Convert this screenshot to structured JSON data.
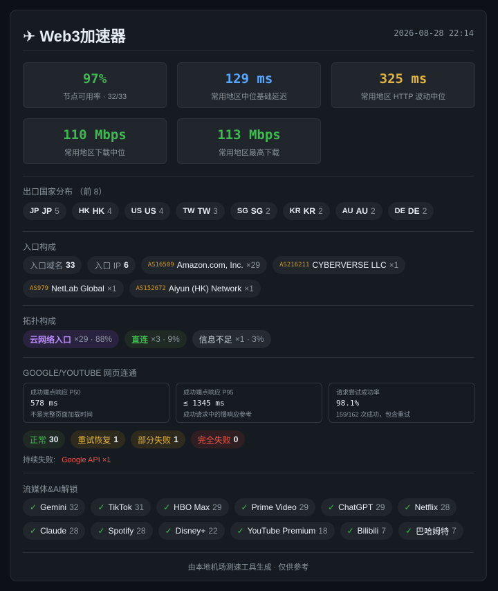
{
  "header": {
    "plane_icon": "airplane-icon",
    "title": "Web3加速器",
    "datetime": "2026-08-28 22:14"
  },
  "stats": [
    {
      "value": "97%",
      "label": "节点可用率 · 32/33",
      "color": "#3fb950"
    },
    {
      "value": "129 ms",
      "label": "常用地区中位基础延迟",
      "color": "#58a6ff"
    },
    {
      "value": "325 ms",
      "label": "常用地区 HTTP 波动中位",
      "color": "#e3b341"
    },
    {
      "value": "110 Mbps",
      "label": "常用地区下载中位",
      "color": "#3fb950"
    },
    {
      "value": "113 Mbps",
      "label": "常用地区最高下载",
      "color": "#3fb950"
    }
  ],
  "countries": {
    "title": "出口国家分布 （前 8）",
    "items": [
      {
        "code": "JP",
        "name": "JP",
        "count": "5"
      },
      {
        "code": "HK",
        "name": "HK",
        "count": "4"
      },
      {
        "code": "US",
        "name": "US",
        "count": "4"
      },
      {
        "code": "TW",
        "name": "TW",
        "count": "3"
      },
      {
        "code": "SG",
        "name": "SG",
        "count": "2"
      },
      {
        "code": "KR",
        "name": "KR",
        "count": "2"
      },
      {
        "code": "AU",
        "name": "AU",
        "count": "2"
      },
      {
        "code": "DE",
        "name": "DE",
        "count": "2"
      }
    ]
  },
  "entry": {
    "title": "入口构成",
    "domain_label": "入口域名",
    "domain_count": "33",
    "ip_label": "入口 IP",
    "ip_count": "6",
    "asns": [
      {
        "asn": "AS16509",
        "name": "Amazon.com, Inc.",
        "count": "×29"
      },
      {
        "asn": "AS216211",
        "name": "CYBERVERSE LLC",
        "count": "×1"
      },
      {
        "asn": "AS979",
        "name": "NetLab Global",
        "count": "×1"
      },
      {
        "asn": "AS152672",
        "name": "Aiyun (HK) Network",
        "count": "×1"
      }
    ]
  },
  "topology": {
    "title": "拓扑构成",
    "items": [
      {
        "tag": "云网络入口",
        "detail": "×29 · 88%",
        "color": "#bc8cff",
        "bg": "#2a2340"
      },
      {
        "tag": "直连",
        "detail": "×3 · 9%",
        "color": "#3fb950",
        "bg": "#1f2a24"
      },
      {
        "tag": "信息不足",
        "detail": "×1 · 3%",
        "color": "#c9d1d9",
        "bg": "#262b32"
      }
    ]
  },
  "google": {
    "title": "GOOGLE/YOUTUBE 网页连通",
    "metrics": [
      {
        "label": "成功端点响应 P50",
        "value": "578 ms",
        "note": "不是完整页面加载时间"
      },
      {
        "label": "成功端点响应 P95",
        "value": "≤ 1345 ms",
        "note": "成功请求中的慢响应参考"
      },
      {
        "label": "请求尝试成功率",
        "value": "98.1%",
        "note": "159/162 次成功，包含重试"
      }
    ],
    "statuses": [
      {
        "label": "正常",
        "count": "30",
        "color": "#3fb950",
        "bg": "#1f2a24"
      },
      {
        "label": "重试恢复",
        "count": "1",
        "color": "#e3b341",
        "bg": "#2e2a1e"
      },
      {
        "label": "部分失败",
        "count": "1",
        "color": "#e3b341",
        "bg": "#2e2a1e"
      },
      {
        "label": "完全失败",
        "count": "0",
        "color": "#f85149",
        "bg": "#2f1f22"
      }
    ],
    "persist_label": "持续失败:",
    "persist_value": "Google API ×1"
  },
  "streaming": {
    "title": "流媒体&AI解锁",
    "items": [
      {
        "name": "Gemini",
        "count": "32"
      },
      {
        "name": "TikTok",
        "count": "31"
      },
      {
        "name": "HBO Max",
        "count": "29"
      },
      {
        "name": "Prime Video",
        "count": "29"
      },
      {
        "name": "ChatGPT",
        "count": "29"
      },
      {
        "name": "Netflix",
        "count": "28"
      },
      {
        "name": "Claude",
        "count": "28"
      },
      {
        "name": "Spotify",
        "count": "28"
      },
      {
        "name": "Disney+",
        "count": "22"
      },
      {
        "name": "YouTube Premium",
        "count": "18"
      },
      {
        "name": "Bilibili",
        "count": "7"
      },
      {
        "name": "巴哈姆特",
        "count": "7"
      }
    ]
  },
  "footer": "由本地机场测速工具生成 · 仅供参考"
}
